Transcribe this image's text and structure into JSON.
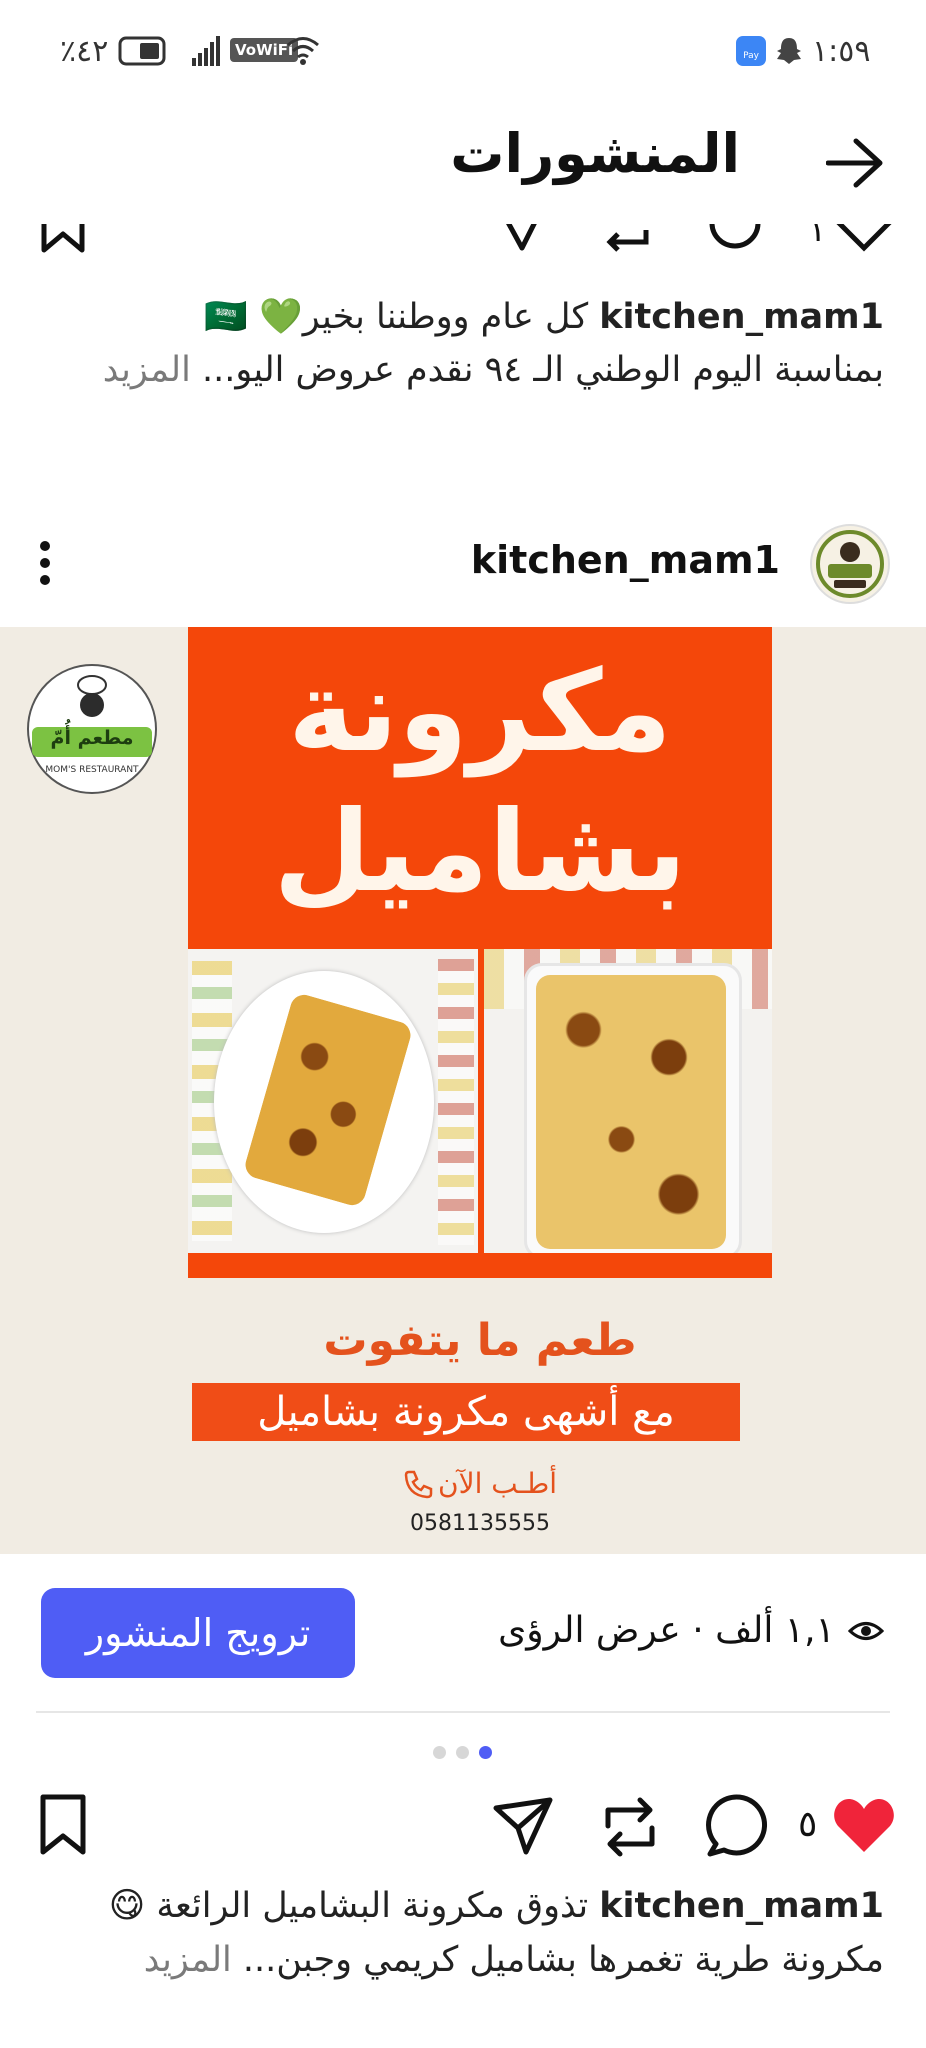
{
  "status_bar": {
    "battery": "٪٤٢",
    "network": "VoWiFi",
    "time": "١:٥٩",
    "pay_badge": "Pay"
  },
  "header": {
    "title": "المنشورات"
  },
  "prev_post": {
    "username": "kitchen_mam1",
    "caption_line1": " كل عام ووطننا بخير💚 🇸🇦",
    "caption_line2": "بمناسبة اليوم الوطني الـ ٩٤ نقدم عروض اليو...",
    "more": "المزيد",
    "like_count": "١"
  },
  "post": {
    "username": "kitchen_mam1",
    "avatar_text": "مطبخ ماما KITCHEN MAMA",
    "image": {
      "title_line1": "مكرونة",
      "title_line2": "بشاميل",
      "logo_ar": "مطعم أُمّ",
      "logo_en": "MOM'S RESTAURANT",
      "tagline": "طعم ما يتفوت",
      "banner": "مع أشهى مكرونة بشاميل",
      "order_now": "أطـب الآن",
      "phone": "0581135555"
    },
    "views": "١,١ ألف · عرض الرؤى",
    "promote_label": "ترويج المنشور",
    "like_count": "٥",
    "caption_username": "kitchen_mam1",
    "caption_line1": " تذوق مكرونة البشاميل الرائعة 😋",
    "caption_line2": "مكرونة طرية تغمرها بشاميل كريمي وجبن...",
    "more": "المزيد",
    "carousel": {
      "count": 3,
      "active_index": 2
    },
    "colors": {
      "accent": "#4f5df5",
      "orange": "#f4470a",
      "like": "#f0243a"
    }
  }
}
